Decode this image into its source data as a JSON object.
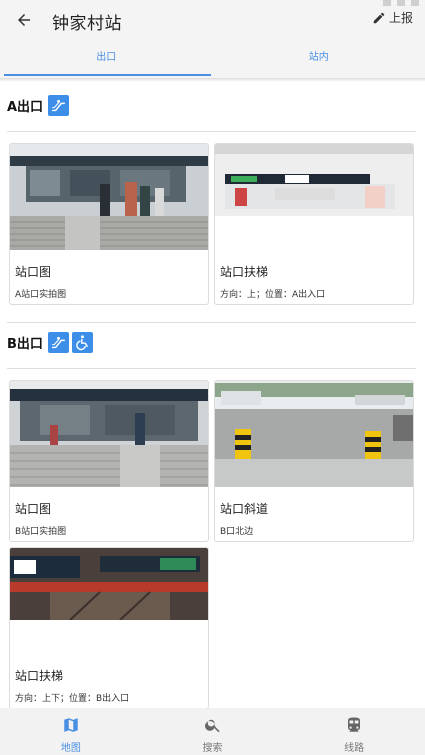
{
  "header": {
    "title": "钟家村站",
    "report_label": "上报"
  },
  "tabs": [
    {
      "label": "出口",
      "active": true
    },
    {
      "label": "站内",
      "active": false
    }
  ],
  "sections": [
    {
      "name": "A出口",
      "facility_icons": [
        "escalator-icon"
      ],
      "cards": [
        {
          "title": "站口图",
          "desc": "A站口实拍图"
        },
        {
          "title": "站口扶梯",
          "desc": "方向：上；位置：A出入口"
        }
      ]
    },
    {
      "name": "B出口",
      "facility_icons": [
        "escalator-icon",
        "wheelchair-icon"
      ],
      "cards": [
        {
          "title": "站口图",
          "desc": "B站口实拍图"
        },
        {
          "title": "站口斜道",
          "desc": "B口北边"
        },
        {
          "title": "站口扶梯",
          "desc": "方向：上下；位置：B出入口"
        }
      ]
    }
  ],
  "bottom_nav": [
    {
      "label": "地图",
      "icon": "map-icon",
      "active": true
    },
    {
      "label": "搜索",
      "icon": "search-icon",
      "active": false
    },
    {
      "label": "线路",
      "icon": "train-icon",
      "active": false
    }
  ],
  "colors": {
    "accent": "#4a90e2",
    "badge": "#3d8ee8",
    "appbar": "#f4f4f4"
  }
}
